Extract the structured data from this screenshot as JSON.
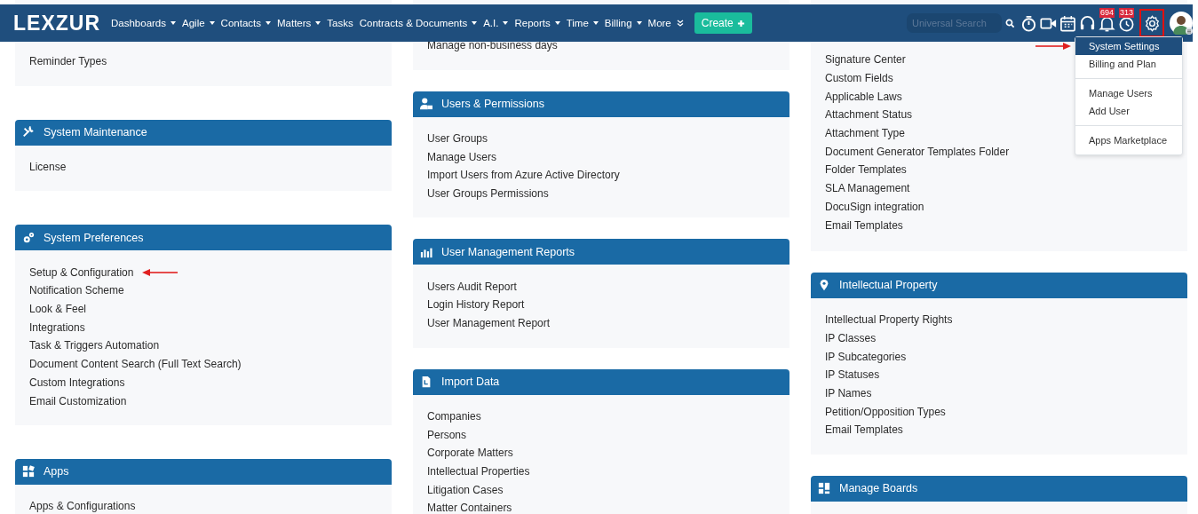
{
  "header": {
    "logo": "LEXZUR",
    "nav": [
      {
        "label": "Dashboards",
        "kind": "dropdown"
      },
      {
        "label": "Agile",
        "kind": "dropdown"
      },
      {
        "label": "Contacts",
        "kind": "dropdown"
      },
      {
        "label": "Matters",
        "kind": "dropdown"
      },
      {
        "label": "Tasks",
        "kind": "link"
      },
      {
        "label": "Contracts & Documents",
        "kind": "dropdown"
      },
      {
        "label": "A.I.",
        "kind": "dropdown"
      },
      {
        "label": "Reports",
        "kind": "dropdown"
      },
      {
        "label": "Time",
        "kind": "dropdown"
      },
      {
        "label": "Billing",
        "kind": "dropdown"
      },
      {
        "label": "More",
        "kind": "more"
      }
    ],
    "create_button": "Create",
    "search": {
      "placeholder": "Universal Search"
    },
    "notification_count": "694",
    "reminder_count": "313",
    "settings_highlighted": true
  },
  "settings_menu": [
    [
      {
        "label": "System Settings",
        "selected": true,
        "annotated": true
      },
      {
        "label": "Billing and Plan",
        "selected": false,
        "annotated": false
      }
    ],
    [
      {
        "label": "Manage Users",
        "selected": false,
        "annotated": false
      },
      {
        "label": "Add User",
        "selected": false,
        "annotated": false
      }
    ],
    [
      {
        "label": "Apps Marketplace",
        "selected": false,
        "annotated": false
      }
    ]
  ],
  "columns": [
    [
      {
        "items": [
          {
            "label": "Reminder Types",
            "annotated": false
          }
        ]
      },
      {
        "title": "System Maintenance",
        "kind": "tools",
        "items": [
          {
            "label": "License",
            "annotated": false
          }
        ]
      },
      {
        "title": "System Preferences",
        "kind": "gears",
        "items": [
          {
            "label": "Setup & Configuration",
            "annotated": true
          },
          {
            "label": "Notification Scheme",
            "annotated": false
          },
          {
            "label": "Look & Feel",
            "annotated": false
          },
          {
            "label": "Integrations",
            "annotated": false
          },
          {
            "label": "Task & Triggers Automation",
            "annotated": false
          },
          {
            "label": "Document Content Search (Full Text Search)",
            "annotated": false
          },
          {
            "label": "Custom Integrations",
            "annotated": false
          },
          {
            "label": "Email Customization",
            "annotated": false
          }
        ]
      },
      {
        "title": "Apps",
        "kind": "apps",
        "items": [
          {
            "label": "Apps & Configurations",
            "annotated": false
          }
        ]
      }
    ],
    [
      {
        "items": [
          {
            "label": "Manage non-business days",
            "annotated": false
          }
        ]
      },
      {
        "title": "Users & Permissions",
        "kind": "userlock",
        "items": [
          {
            "label": "User Groups",
            "annotated": false
          },
          {
            "label": "Manage Users",
            "annotated": false
          },
          {
            "label": "Import Users from Azure Active Directory",
            "annotated": false
          },
          {
            "label": "User Groups Permissions",
            "annotated": false
          }
        ]
      },
      {
        "title": "User Management Reports",
        "kind": "chart",
        "items": [
          {
            "label": "Users Audit Report",
            "annotated": false
          },
          {
            "label": "Login History Report",
            "annotated": false
          },
          {
            "label": "User Management Report",
            "annotated": false
          }
        ]
      },
      {
        "title": "Import Data",
        "kind": "import",
        "items": [
          {
            "label": "Companies",
            "annotated": false
          },
          {
            "label": "Persons",
            "annotated": false
          },
          {
            "label": "Corporate Matters",
            "annotated": false
          },
          {
            "label": "Intellectual Properties",
            "annotated": false
          },
          {
            "label": "Litigation Cases",
            "annotated": false
          },
          {
            "label": "Matter Containers",
            "annotated": false
          }
        ]
      }
    ],
    [
      {
        "items": [
          {
            "label": "Signature Center",
            "annotated": false
          },
          {
            "label": "Custom Fields",
            "annotated": false
          },
          {
            "label": "Applicable Laws",
            "annotated": false
          },
          {
            "label": "Attachment Status",
            "annotated": false
          },
          {
            "label": "Attachment Type",
            "annotated": false
          },
          {
            "label": "Document Generator Templates Folder",
            "annotated": false
          },
          {
            "label": "Folder Templates",
            "annotated": false
          },
          {
            "label": "SLA Management",
            "annotated": false
          },
          {
            "label": "DocuSign integration",
            "annotated": false
          },
          {
            "label": "Email Templates",
            "annotated": false
          }
        ]
      },
      {
        "title": "Intellectual Property",
        "kind": "pin",
        "items": [
          {
            "label": "Intellectual Property Rights",
            "annotated": false
          },
          {
            "label": "IP Classes",
            "annotated": false
          },
          {
            "label": "IP Subcategories",
            "annotated": false
          },
          {
            "label": "IP Statuses",
            "annotated": false
          },
          {
            "label": "IP Names",
            "annotated": false
          },
          {
            "label": "Petition/Opposition Types",
            "annotated": false
          },
          {
            "label": "Email Templates",
            "annotated": false
          }
        ]
      },
      {
        "title": "Manage Boards",
        "kind": "boards"
      }
    ]
  ]
}
